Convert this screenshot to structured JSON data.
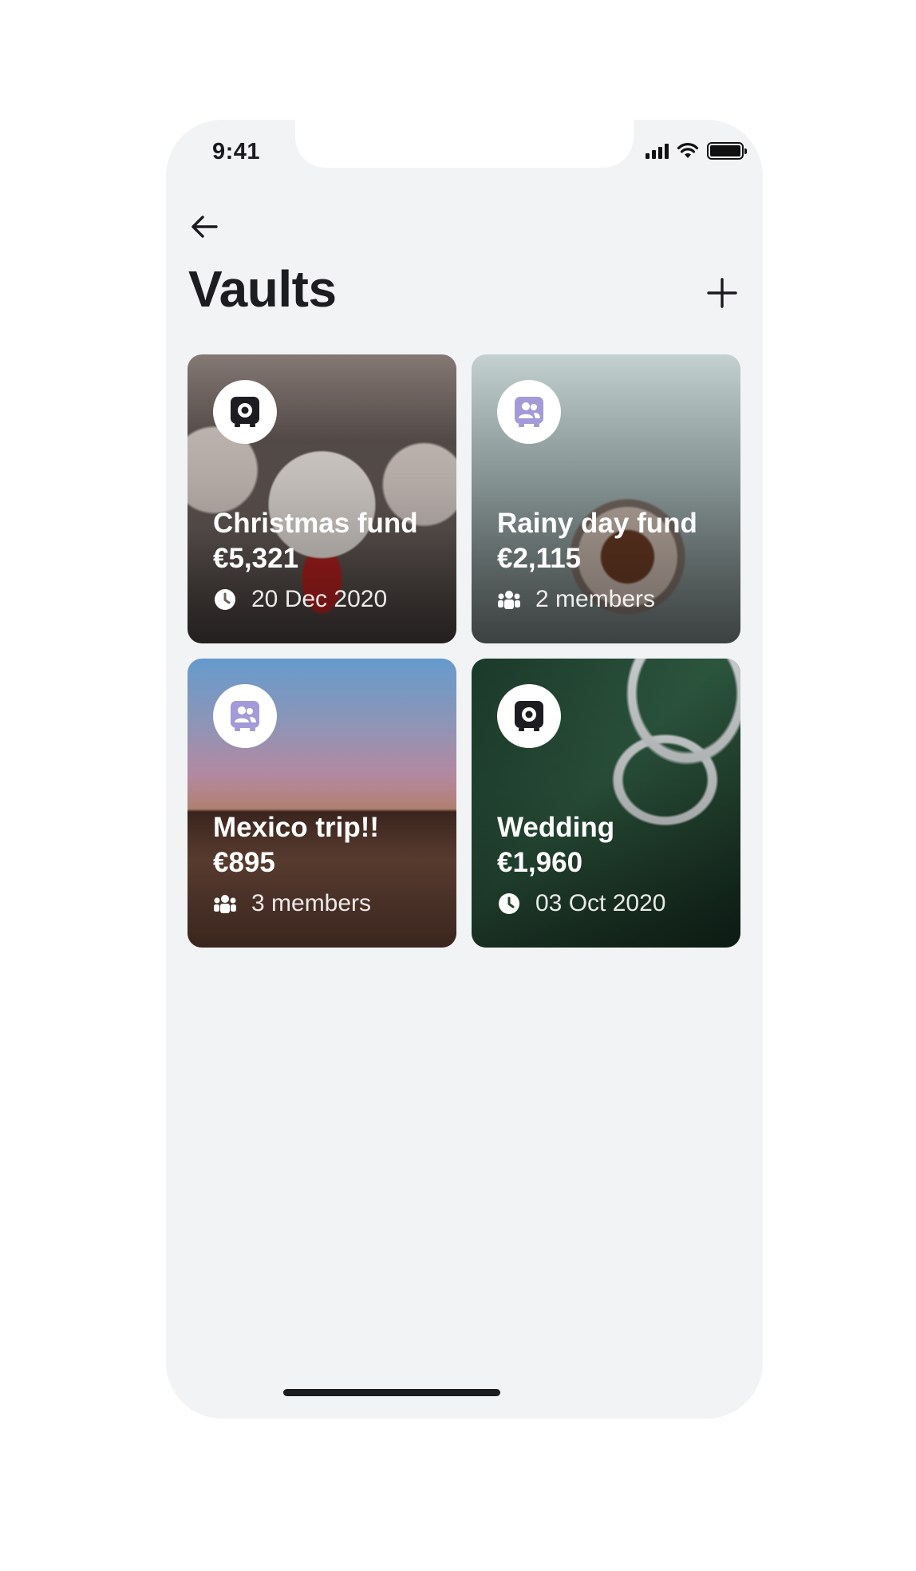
{
  "status_bar": {
    "time": "9:41",
    "icons": [
      "signal-icon",
      "wifi-icon",
      "battery-icon"
    ]
  },
  "header": {
    "back_icon": "arrow-left-icon",
    "title": "Vaults",
    "add_icon": "plus-icon"
  },
  "vaults": [
    {
      "name": "Christmas fund",
      "amount": "€5,321",
      "meta_icon": "clock-icon",
      "meta": "20 Dec 2020",
      "badge_icon": "vault-icon"
    },
    {
      "name": "Rainy day fund",
      "amount": "€2,115",
      "meta_icon": "members-icon",
      "meta": "2 members",
      "badge_icon": "shared-vault-icon"
    },
    {
      "name": "Mexico trip!!",
      "amount": "€895",
      "meta_icon": "members-icon",
      "meta": "3 members",
      "badge_icon": "shared-vault-icon"
    },
    {
      "name": "Wedding",
      "amount": "€1,960",
      "meta_icon": "clock-icon",
      "meta": "03 Oct 2020",
      "badge_icon": "vault-icon"
    }
  ],
  "colors": {
    "background": "#f2f3f5",
    "text": "#1d1d21",
    "shared_badge_icon": "#a39ad8",
    "vault_badge_icon": "#1d1d21"
  }
}
